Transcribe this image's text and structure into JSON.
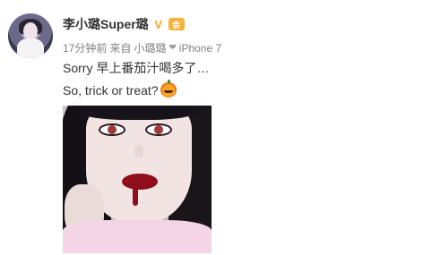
{
  "post": {
    "username": "李小璐Super璐",
    "verified_badge": "V",
    "vip_badge": "会",
    "meta": {
      "time": "17分钟前",
      "from_label": "来自",
      "source": "小璐璐",
      "heart": "❤",
      "device": "iPhone 7"
    },
    "lines": [
      "Sorry 早上番茄汁喝多了…",
      "So, trick or treat?"
    ],
    "emoji": "pumpkin-icon"
  },
  "colors": {
    "username": "#333333",
    "meta": "#808080",
    "badge": "#f3a716"
  }
}
